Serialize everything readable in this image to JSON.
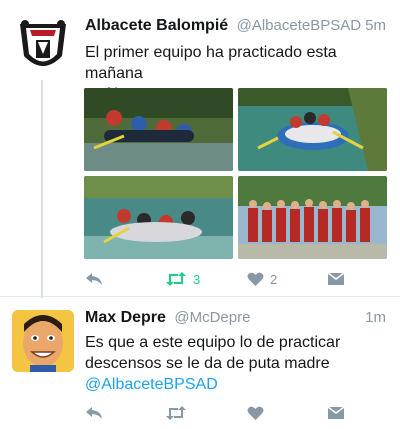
{
  "tweets": [
    {
      "author_name": "Albacete Balompié",
      "author_handle": "@AlbaceteBPSAD",
      "time": "5m",
      "text_line1": "El primer equipo ha practicado esta mañana",
      "text_line2": "Rafting",
      "retweet_count": "3",
      "like_count": "2"
    },
    {
      "author_name": "Max Depre",
      "author_handle": "@McDepre",
      "time": "1m",
      "text_line1": "Es que a este equipo lo de practicar",
      "text_line2": "descensos se le da de puta madre",
      "mention": "@AlbaceteBPSAD"
    }
  ],
  "colors": {
    "link": "#1da1f2",
    "retweet_active": "#19cf86",
    "icon_gray": "#8899a6"
  },
  "icons": [
    "reply-icon",
    "retweet-icon",
    "like-icon",
    "direct-message-icon"
  ]
}
